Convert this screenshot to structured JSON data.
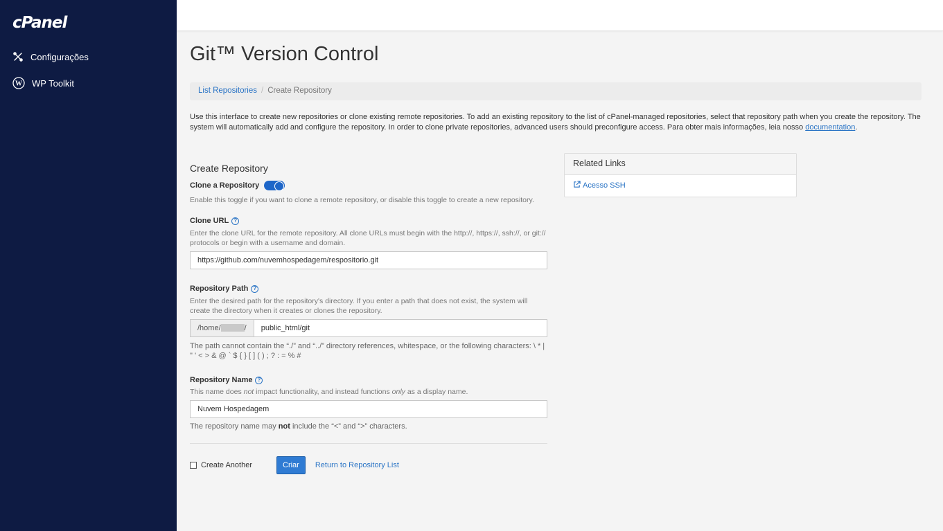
{
  "sidebar": {
    "logo": "cPanel",
    "items": [
      {
        "label": "Configurações",
        "icon": "tools-icon"
      },
      {
        "label": "WP Toolkit",
        "icon": "wordpress-icon"
      }
    ]
  },
  "page": {
    "title": "Git™ Version Control",
    "breadcrumb": {
      "link": "List Repositories",
      "separator": "/",
      "current": "Create Repository"
    },
    "intro_text": "Use this interface to create new repositories or clone existing remote repositories. To add an existing repository to the list of cPanel-managed repositories, select that repository path when you create the repository. The system will automatically add and configure the repository. In order to clone private repositories, advanced users should preconfigure access. Para obter mais informações, leia nosso ",
    "intro_link": "documentation",
    "intro_end": "."
  },
  "form": {
    "section_title": "Create Repository",
    "clone_toggle": {
      "label": "Clone a Repository",
      "checked": true,
      "help": "Enable this toggle if you want to clone a remote repository, or disable this toggle to create a new repository."
    },
    "clone_url": {
      "label": "Clone URL",
      "help": "Enter the clone URL for the remote repository. All clone URLs must begin with the http://, https://, ssh://, or git:// protocols or begin with a username and domain.",
      "value": "https://github.com/nuvemhospedagem/respositorio.git"
    },
    "repo_path": {
      "label": "Repository Path",
      "help": "Enter the desired path for the repository's directory. If you enter a path that does not exist, the system will create the directory when it creates or clones the repository.",
      "prefix_start": "/home/",
      "prefix_end": "/",
      "value": "public_html/git",
      "note": "The path cannot contain the “./” and “../” directory references, whitespace, or the following characters: \\ * | \" ' < > & @ ` $ { } [ ] ( ) ; ? : = % #"
    },
    "repo_name": {
      "label": "Repository Name",
      "help_part1": "This name does ",
      "help_em1": "not",
      "help_part2": " impact functionality, and instead functions ",
      "help_em2": "only",
      "help_part3": " as a display name.",
      "value": "Nuvem Hospedagem",
      "note_part1": "The repository name may ",
      "note_strong": "not",
      "note_part2": " include the “<” and “>” characters."
    },
    "create_another_label": "Create Another",
    "submit_label": "Criar",
    "return_link": "Return to Repository List"
  },
  "related": {
    "title": "Related Links",
    "links": [
      {
        "label": "Acesso SSH",
        "icon": "external-link-icon"
      }
    ]
  },
  "colors": {
    "sidebar_bg": "#0e1b43",
    "accent": "#2a74c5",
    "button": "#2f7bd3"
  }
}
